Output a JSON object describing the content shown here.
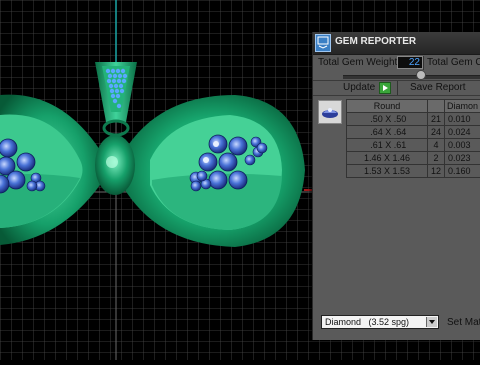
{
  "panel": {
    "title": "GEM REPORTER",
    "total_gem_weight_label": "Total Gem Weight",
    "total_gem_weight_value": "22",
    "total_gem_count_label": "Total Gem Co",
    "update_label": "Update",
    "save_report_label": "Save Report",
    "table": {
      "headers": [
        "Round",
        "",
        "Diamon"
      ],
      "rows": [
        [
          " .50 X .50",
          "21",
          "0.010"
        ],
        [
          " .64 X .64",
          "24",
          "0.024"
        ],
        [
          " .61 X .61",
          "4",
          "0.003"
        ],
        [
          "1.46 X 1.46",
          "2",
          "0.023"
        ],
        [
          "1.53 X 1.53",
          "12",
          "0.160"
        ]
      ]
    },
    "material_select": "Diamond   (3.52 spg)",
    "set_material_label": "Set Mate"
  },
  "colors": {
    "grid": "#4a4a4a",
    "jewelry_green": "#0f8a57",
    "gem_blue": "#3f6fd6",
    "panel_bg": "#5a5a5a",
    "accent_value": "#4da3ff"
  },
  "icons": [
    "gem-reporter-icon",
    "play-icon",
    "gem-thumbnail-icon",
    "dropdown-arrow-icon"
  ]
}
